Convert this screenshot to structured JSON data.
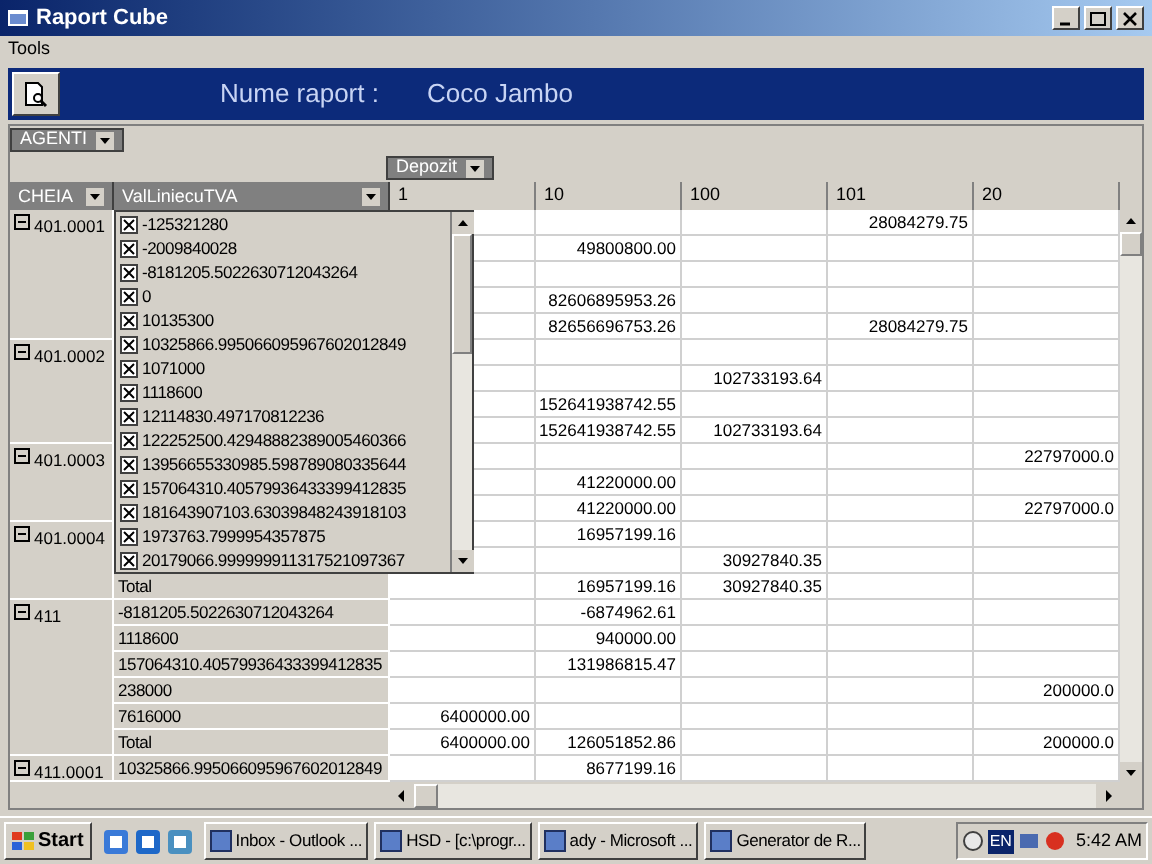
{
  "window": {
    "title": "Raport Cube"
  },
  "menu": [
    {
      "label": "Tools"
    }
  ],
  "banner": {
    "label": "Nume raport :",
    "report_name": "Coco Jambo"
  },
  "filter_fields": [
    {
      "label": "AGENTI"
    }
  ],
  "column_fields": [
    {
      "label": "Depozit"
    }
  ],
  "row_fields": [
    {
      "label": "CHEIA"
    },
    {
      "label": "ValLiniecuTVA"
    }
  ],
  "columns": [
    "1",
    "10",
    "100",
    "101",
    "20"
  ],
  "groups": [
    {
      "key": "401.0001",
      "expanded": true,
      "rows": [
        {
          "cells": [
            null,
            null,
            null,
            "28084279.75",
            null
          ]
        },
        {
          "cells": [
            null,
            "49800800.00",
            null,
            null,
            null
          ]
        },
        {
          "cells": [
            null,
            null,
            null,
            null,
            null
          ]
        },
        {
          "cells": [
            null,
            "82606895953.26",
            null,
            null,
            null
          ]
        },
        {
          "cells": [
            null,
            "82656696753.26",
            null,
            "28084279.75",
            null
          ]
        }
      ]
    },
    {
      "key": "401.0002",
      "expanded": true,
      "rows": [
        {
          "cells": [
            null,
            null,
            null,
            null,
            null
          ]
        },
        {
          "cells": [
            null,
            null,
            "102733193.64",
            null,
            null
          ]
        },
        {
          "cells": [
            null,
            "152641938742.55",
            null,
            null,
            null
          ]
        },
        {
          "cells": [
            null,
            "152641938742.55",
            "102733193.64",
            null,
            null
          ]
        }
      ]
    },
    {
      "key": "401.0003",
      "expanded": true,
      "rows": [
        {
          "cells": [
            null,
            null,
            null,
            null,
            "22797000.0"
          ]
        },
        {
          "cells": [
            null,
            "41220000.00",
            null,
            null,
            null
          ]
        },
        {
          "cells": [
            null,
            "41220000.00",
            null,
            null,
            "22797000.0"
          ]
        }
      ]
    },
    {
      "key": "401.0004",
      "expanded": true,
      "rows": [
        {
          "cells": [
            null,
            "16957199.16",
            null,
            null,
            null
          ]
        },
        {
          "cells": [
            null,
            null,
            "30927840.35",
            null,
            null
          ]
        },
        {
          "value": "Total",
          "cells": [
            null,
            "16957199.16",
            "30927840.35",
            null,
            null
          ]
        }
      ]
    },
    {
      "key": "411",
      "expanded": true,
      "rows": [
        {
          "value": "-8181205.5022630712043264",
          "cells": [
            null,
            "-6874962.61",
            null,
            null,
            null
          ]
        },
        {
          "value": "1118600",
          "cells": [
            null,
            "940000.00",
            null,
            null,
            null
          ]
        },
        {
          "value": "157064310.40579936433399412835",
          "cells": [
            null,
            "131986815.47",
            null,
            null,
            null
          ]
        },
        {
          "value": "238000",
          "cells": [
            null,
            null,
            null,
            null,
            "200000.0"
          ]
        },
        {
          "value": "7616000",
          "cells": [
            "6400000.00",
            null,
            null,
            null,
            null
          ]
        },
        {
          "value": "Total",
          "cells": [
            "6400000.00",
            "126051852.86",
            null,
            null,
            "200000.0"
          ]
        }
      ]
    },
    {
      "key": "411.0001",
      "expanded": true,
      "rows": [
        {
          "value": "10325866.995066095967602012849",
          "cells": [
            null,
            "8677199.16",
            null,
            null,
            null
          ]
        }
      ]
    }
  ],
  "dropdown": {
    "items": [
      {
        "label": "-125321280",
        "checked": true
      },
      {
        "label": "-2009840028",
        "checked": true
      },
      {
        "label": "-8181205.5022630712043264",
        "checked": true
      },
      {
        "label": "0",
        "checked": true
      },
      {
        "label": "10135300",
        "checked": true
      },
      {
        "label": "10325866.995066095967602012849",
        "checked": true
      },
      {
        "label": "1071000",
        "checked": true
      },
      {
        "label": "1118600",
        "checked": true
      },
      {
        "label": "12114830.497170812236",
        "checked": true
      },
      {
        "label": "122252500.42948882389005460366",
        "checked": true
      },
      {
        "label": "13956655330985.598789080335644",
        "checked": true
      },
      {
        "label": "157064310.40579936433399412835",
        "checked": true
      },
      {
        "label": "181643907103.63039848243918103",
        "checked": true
      },
      {
        "label": "1973763.7999954357875",
        "checked": true
      },
      {
        "label": "20179066.999999911317521097367",
        "checked": true
      }
    ]
  },
  "taskbar": {
    "start": "Start",
    "tasks": [
      {
        "label": "Inbox - Outlook ..."
      },
      {
        "label": "HSD - [c:\\progr..."
      },
      {
        "label": "ady - Microsoft ..."
      },
      {
        "label": "Generator de R..."
      }
    ],
    "language": "EN",
    "clock": "5:42 AM"
  }
}
